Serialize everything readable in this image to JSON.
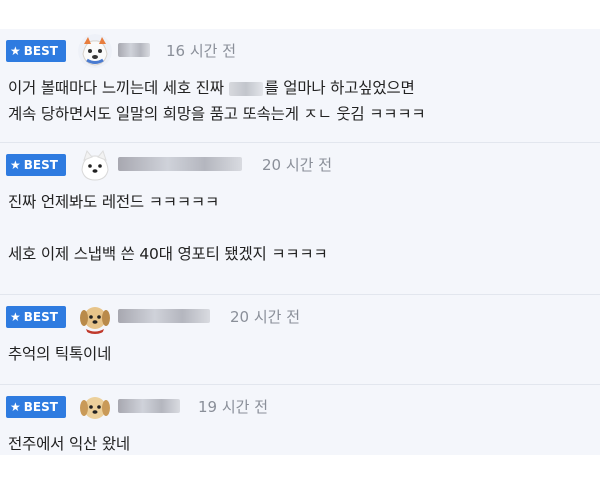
{
  "comments": [
    {
      "badge": "BEST",
      "badge_icon": "star-icon",
      "avatar": "dog-avatar",
      "time": "16 시간 전",
      "line1_a": "이거 볼때마다 느끼는데 세호 진짜 ",
      "line1_b": "를 얼마나 하고싶었으면",
      "line2": "계속 당하면서도 일말의 희망을 품고 또속는게 ㅈㄴ 웃김 ㅋㅋㅋㅋ"
    },
    {
      "badge": "BEST",
      "badge_icon": "star-icon",
      "avatar": "white-dog-avatar",
      "time": "20 시간 전",
      "line1": "진짜 언제봐도 레전드 ㅋㅋㅋㅋㅋ",
      "line2": "세호 이제 스냅백 쓴 40대 영포티 됐겠지 ㅋㅋㅋㅋ"
    },
    {
      "badge": "BEST",
      "badge_icon": "star-icon",
      "avatar": "puppy-avatar",
      "time": "20 시간 전",
      "line1": "추억의 틱톡이네"
    },
    {
      "badge": "BEST",
      "badge_icon": "star-icon",
      "avatar": "puppy-avatar",
      "time": "19 시간 전",
      "line1": "전주에서 익산 왔네"
    }
  ],
  "colors": {
    "badge": "#2e7be0",
    "background": "#f4f6fb",
    "time": "#8a8f99"
  }
}
